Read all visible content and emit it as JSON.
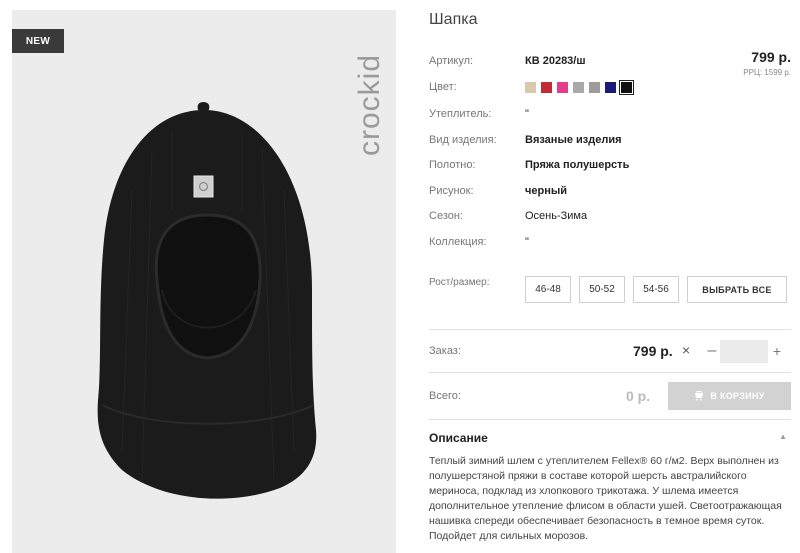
{
  "product": {
    "badge": "NEW",
    "brand": "crockid",
    "title": "Шапка"
  },
  "fields": {
    "article_label": "Артикул:",
    "article_value": "КВ 20283/ш",
    "color_label": "Цвет:",
    "insulation_label": "Утеплитель:",
    "insulation_value": "\"",
    "type_label": "Вид изделия:",
    "type_value": "Вязаные изделия",
    "fabric_label": "Полотно:",
    "fabric_value": "Пряжа полушерсть",
    "pattern_label": "Рисунок:",
    "pattern_value": "черный",
    "season_label": "Сезон:",
    "season_value": "Осень-Зима",
    "collection_label": "Коллекция:",
    "collection_value": "\"",
    "size_label": "Рост/размер:"
  },
  "price": {
    "main": "799 р.",
    "rrc": "РРЦ: 1599 р."
  },
  "colors": [
    "#d8c9ad",
    "#c22a36",
    "#e43e8a",
    "#a9a9a9",
    "#9c9c9c",
    "#1a1a7a",
    "#111111"
  ],
  "selected_color_index": 6,
  "sizes": [
    "46-48",
    "50-52",
    "54-56"
  ],
  "select_all_label": "ВЫБРАТЬ ВСЕ",
  "order": {
    "label": "Заказ:",
    "price": "799 р.",
    "multiply": "×",
    "minus": "–",
    "plus": "+",
    "quantity": ""
  },
  "total": {
    "label": "Всего:",
    "value": "0 р.",
    "cart_label": "В КОРЗИНУ"
  },
  "description": {
    "heading": "Описание",
    "toggle": "▲",
    "text": "Теплый зимний шлем с утеплителем Fellex® 60 г/м2. Верх выполнен из полушерстяной пряжи в составе которой шерсть австралийского мериноса, подклад из хлопкового трикотажа. У шлема имеется дополнительное утепление флисом в области ушей. Светоотражающая нашивка спереди обеспечивает безопасность в темное время суток. Подойдет для сильных морозов."
  }
}
